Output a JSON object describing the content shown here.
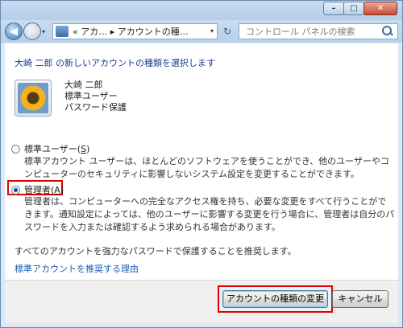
{
  "window": {
    "caption_minimize": "–",
    "caption_maximize": "□",
    "caption_close": "✕"
  },
  "nav": {
    "back_icon": "◀",
    "forward_icon": "▶",
    "dropdown_icon": "▾",
    "address_text": "« アカ… ▸ アカウントの種…",
    "address_dropdown_icon": "▾",
    "refresh_icon": "↻",
    "search_placeholder": "コントロール パネルの検索"
  },
  "content": {
    "heading": "大崎 二郎 の新しいアカウントの種類を選択します",
    "user": {
      "name": "大崎 二郎",
      "type": "標準ユーザー",
      "protection": "パスワード保護"
    },
    "options": [
      {
        "label_prefix": "標準ユーザー(",
        "label_accel": "S",
        "label_suffix": ")",
        "checked": false,
        "description": "標準アカウント ユーザーは、ほとんどのソフトウェアを使うことができ、他のユーザーやコンピューターのセキュリティに影響しないシステム設定を変更することができます。"
      },
      {
        "label_prefix": "管理者(",
        "label_accel": "A",
        "label_suffix": ")",
        "checked": true,
        "description": "管理者は、コンピューターへの完全なアクセス権を持ち、必要な変更をすべて行うことができます。通知設定によっては、他のユーザーに影響する変更を行う場合に、管理者は自分のパスワードを入力または確認するよう求められる場合があります。"
      }
    ],
    "recommendation": "すべてのアカウントを強力なパスワードで保護することを推奨します。",
    "link": "標準アカウントを推奨する理由"
  },
  "footer": {
    "change_button": "アカウントの種類の変更",
    "cancel_button": "キャンセル"
  },
  "colors": {
    "highlight": "#e00000",
    "heading": "#1a3d8f",
    "link": "#1c5cb3"
  }
}
